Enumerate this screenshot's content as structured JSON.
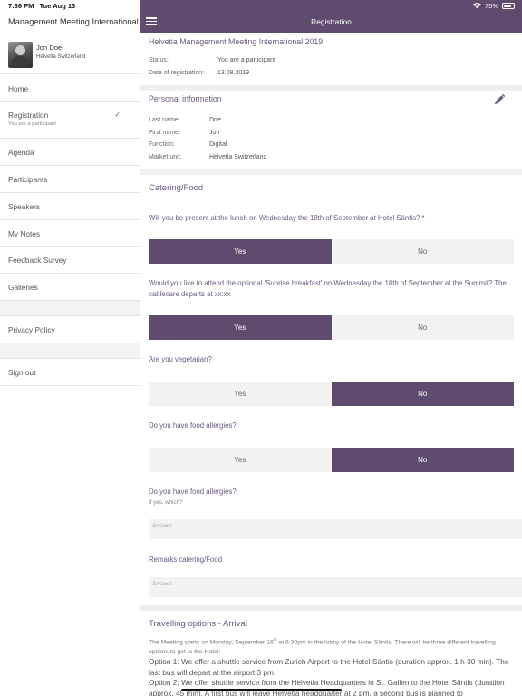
{
  "status_bar": {
    "time": "7:36 PM",
    "date": "Tue Aug 13",
    "battery": "75%",
    "battery_level": 0.75
  },
  "sidebar": {
    "app_title": "Management Meeting International",
    "user": {
      "name": "Jon Doe",
      "subtitle": "Helvetia Switzerland"
    },
    "items": [
      {
        "label": "Home"
      },
      {
        "label": "Registration",
        "sub": "You are a participant",
        "checked": true
      },
      {
        "label": "Agenda"
      },
      {
        "label": "Participants"
      },
      {
        "label": "Speakers"
      },
      {
        "label": "My Notes"
      },
      {
        "label": "Feedback Survey"
      },
      {
        "label": "Galleries"
      },
      {
        "label": "Privacy Policy"
      },
      {
        "label": "Sign out"
      }
    ]
  },
  "header": {
    "title": "Registration"
  },
  "event": {
    "title": "Helvetia Management Meeting International 2019",
    "status_label": "Status:",
    "status_value": "You are a participant",
    "date_label": "Date of registration:",
    "date_value": "13.08.2019"
  },
  "personal": {
    "title": "Personal information",
    "last_name_label": "Last name:",
    "last_name": "Doe",
    "first_name_label": "First name:",
    "first_name": "Jon",
    "function_label": "Function:",
    "function": "Digital",
    "market_label": "Market unit:",
    "market": "Helvetia Switzerland"
  },
  "catering": {
    "title": "Catering/Food",
    "yes": "Yes",
    "no": "No",
    "q1": "Will you be present at the lunch on Wednesday the 18th of September at Hotel Säntis? *",
    "q1_answer": "Yes",
    "q2": "Would you like to attend the optional 'Sunrise breakfast' on Wednesday the 18th of September at the Summit? The cablecare departs at xx:xx",
    "q2_answer": "Yes",
    "q3": "Are you vegetarian?",
    "q3_answer": "No",
    "q4": "Do you have food allergies?",
    "q4_answer": "No",
    "q5": "Do you have food allergies?",
    "q5_hint": "If yes, which?",
    "answer_placeholder": "Answer",
    "remarks_label": "Remarks catering/Food"
  },
  "travel": {
    "title": "Travelling options - Arrival",
    "intro_a": "The Meeting starts on Monday, September 16",
    "intro_sup": "th",
    "intro_b": " at 6:30pm in the lobby of the Hotel Säntis. There will be three different travelling options to get to the Hotel:",
    "option1": "Option 1: We offer a shuttle service from Zurich Airport to the Hotel Säntis (duration approx. 1 h 30 min). The last bus will depart at the airport 3 pm.",
    "option2": "Option 2: We offer shuttle service from the Helvetia Headquarters in St. Gallen to the Hotel Säntis (duration approx. 45 min). A first bus will leave Helvetia headquarter at 2 pm, a second bus is planned to"
  },
  "colors": {
    "accent": "#5e4b6e",
    "accent_text": "#6b5a7c",
    "toggle_off": "#f2f2f2",
    "separator": "#f0f0f0"
  }
}
